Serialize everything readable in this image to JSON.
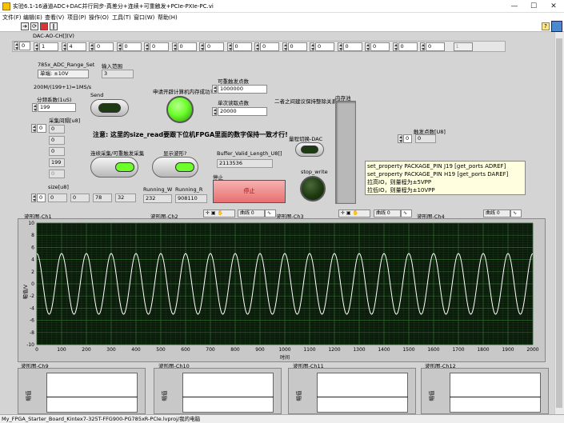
{
  "window": {
    "title": "实验6.1-16通道ADC+DAC并行同步-真差分+连续+可重触发+PCIe-PXIe-PC.vi",
    "controls": {
      "minimize": "—",
      "maximize": "☐",
      "close": "✕"
    }
  },
  "menu": [
    "文件(F)",
    "编辑(E)",
    "查看(V)",
    "项目(P)",
    "操作(O)",
    "工具(T)",
    "窗口(W)",
    "帮助(H)"
  ],
  "toolbar": {
    "icons": [
      "run-arrow-icon",
      "run-continuous-icon",
      "abort-icon",
      "pause-icon"
    ],
    "help": "?"
  },
  "dac": {
    "label": "DAC-AO-CH[](V)",
    "index": "0",
    "values": [
      "1",
      "4",
      "0",
      "0",
      "0",
      "0",
      "0",
      "0",
      "0",
      "0",
      "0",
      "0",
      "0",
      "0",
      "0",
      "1"
    ]
  },
  "range": {
    "label": "785x_ADC_Range_Set",
    "value": "单端: ±10V",
    "input_label": "输入范围",
    "input_value": "3"
  },
  "rate_text": "200M/(199+1)=1MS/s",
  "divider": {
    "label": "分频系数(1uS)",
    "value": "199"
  },
  "send": {
    "label": "Send"
  },
  "mem_ok": {
    "label": "申请开辟计算机内存成功?"
  },
  "retrigger": {
    "label": "可重触发点数",
    "value": "1000000"
  },
  "single_read": {
    "label": "单次读取点数",
    "value": "20000"
  },
  "int_note": "二者之间建议保持整除关系!",
  "memory_pool": {
    "label": "内存池"
  },
  "sample_interval": {
    "label": "采集间隔[u8]",
    "index": "0",
    "values": [
      "0",
      "0",
      "0",
      "199",
      "0"
    ]
  },
  "warning": "注意: 这里的size_read要跟下位机FPGA里面的数字保持一致才行!",
  "range_switch": {
    "label": "量程切换-DAC"
  },
  "trigger_count": {
    "label": "触发点数[U8]",
    "index": "0",
    "value": "0"
  },
  "continuous": {
    "label": "连续采集/可重触发采集"
  },
  "show_wave": {
    "label": "显示波形?"
  },
  "buffer": {
    "label": "Buffer_Valid_Length_U8[]",
    "value": "2113536"
  },
  "stop_write": {
    "label": "stop_write"
  },
  "note": [
    "set_property PACKAGE_PIN J19 [get_ports ADREF]",
    "set_property PACKAGE_PIN H19 [get_ports DAREF]",
    "拉高IO，则量程为±5VPP",
    "拉低IO，则量程为±10VPP"
  ],
  "size": {
    "label": "size[u8]",
    "index": "0",
    "values": [
      "0",
      "0",
      "78",
      "32"
    ]
  },
  "running_w": {
    "label": "Running_W",
    "value": "232"
  },
  "running_r": {
    "label": "Running_R",
    "value": "908110"
  },
  "stop": {
    "label": "停止",
    "button": "停止"
  },
  "graph_tabs": {
    "ch1": "波形图-Ch1",
    "ch2": "波形图-Ch2",
    "ch3": "波形图-Ch3",
    "ch4": "波形图-Ch4",
    "ch9": "波形图-Ch9",
    "ch10": "波形图-Ch10",
    "ch11": "波形图-Ch11",
    "ch12": "波形图-Ch12"
  },
  "legend": {
    "curve": "曲线 0"
  },
  "status_path": "My_FPGA_Starter_Board_Kintex7-325T-FFG900-PG785xR-PCIe.lvproj/我的电脑",
  "colors": {
    "plot_bg": "#0b1a0b",
    "grid": "#2f6b2f",
    "trace": "#ffffff",
    "led_on": "#6cff2a",
    "led_off": "#2a4a1a",
    "stop_btn": "#f08080"
  },
  "chart_data": {
    "type": "line",
    "title": "",
    "xlabel": "时间",
    "ylabel": "幅值/V",
    "xlim": [
      0,
      2000
    ],
    "ylim": [
      -10,
      10
    ],
    "x_ticks": [
      0,
      100,
      200,
      300,
      400,
      500,
      600,
      700,
      800,
      900,
      1000,
      1100,
      1200,
      1300,
      1400,
      1500,
      1600,
      1700,
      1800,
      1900,
      2000
    ],
    "y_ticks": [
      -10,
      -8,
      -6,
      -4,
      -2,
      0,
      2,
      4,
      6,
      8,
      10
    ],
    "series": [
      {
        "amplitude": 5,
        "offset": 0,
        "cycles": 20
      }
    ],
    "grid": true
  },
  "mini_charts": {
    "ylabel": "幅值"
  }
}
